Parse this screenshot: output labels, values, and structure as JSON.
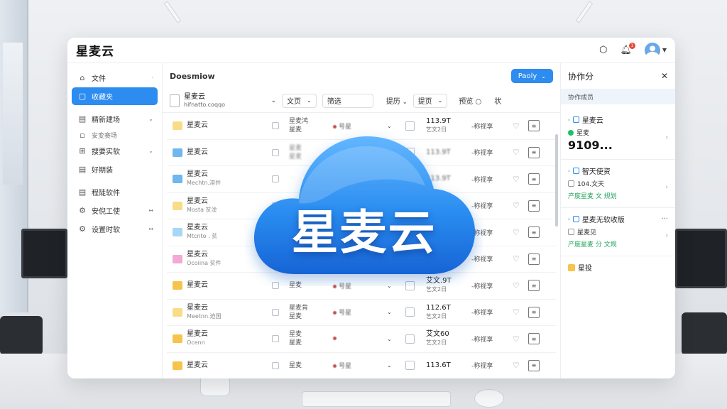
{
  "app": {
    "title": "星麦云",
    "notification_badge": "1"
  },
  "sidebar": {
    "items": [
      {
        "label": "文件",
        "icon": "home-icon",
        "arrow": "·",
        "active": false
      },
      {
        "label": "收藏夹",
        "icon": "folder-icon",
        "arrow": "",
        "active": true
      },
      {
        "label": "精新建场",
        "icon": "doc-icon",
        "arrow": "⌄",
        "active": false
      },
      {
        "label": "安变赛场",
        "icon": "square-icon",
        "arrow": "",
        "active": false,
        "sub": true
      },
      {
        "label": "搜要实软",
        "icon": "clip-icon",
        "arrow": "⌄",
        "active": false
      },
      {
        "label": "好期装",
        "icon": "doc-icon",
        "arrow": "",
        "active": false
      },
      {
        "label": "程陡软件",
        "icon": "doc-icon",
        "arrow": "",
        "active": false
      },
      {
        "label": "安倪工使",
        "icon": "gear-icon",
        "arrow": "↔",
        "active": false
      },
      {
        "label": "设置时软",
        "icon": "gear-icon",
        "arrow": "↔",
        "active": false
      }
    ]
  },
  "main": {
    "title": "Doesmiow",
    "primary_button": "Paoly",
    "filters": {
      "folder_title": "星麦云",
      "folder_sub": "hifnatto.coqqo",
      "type_label": "文页",
      "search_label": "筛选",
      "sort_label": "提历",
      "sort2_label": "提页",
      "view_label": "预览",
      "more_label": "状"
    },
    "rows": [
      {
        "name": "星麦云",
        "sub": "",
        "icon": "ylt",
        "owner": "星麦鸿",
        "owner_sub": "星麦",
        "tag": "号星",
        "size": "113.9T",
        "size_sub": "艺文2日",
        "date": "-称视享"
      },
      {
        "name": "星麦云",
        "sub": "",
        "icon": "b",
        "owner": "星麦",
        "owner_sub": "星麦",
        "tag": "",
        "size": "113.9T",
        "size_sub": "",
        "date": "-称视享"
      },
      {
        "name": "星麦云",
        "sub": "Mechtn.滞井",
        "icon": "b",
        "owner": "",
        "owner_sub": "",
        "tag": "",
        "size": "113.9T",
        "size_sub": "",
        "date": "-称视享"
      },
      {
        "name": "星麦云",
        "sub": "Mosta 贫淦",
        "icon": "ylt",
        "owner": "",
        "owner_sub": "",
        "tag": "",
        "size": "",
        "size_sub": "",
        "date": "-称视享"
      },
      {
        "name": "星麦云",
        "sub": "Mtcnto . 贫",
        "icon": "blt",
        "owner": "",
        "owner_sub": "",
        "tag": "",
        "size": "",
        "size_sub": "",
        "date": "-称视享"
      },
      {
        "name": "星麦云",
        "sub": "Ocoiina 贫件",
        "icon": "p",
        "owner": "",
        "owner_sub": "",
        "tag": "",
        "size": "",
        "size_sub": "",
        "date": "-称视享"
      },
      {
        "name": "星麦云",
        "sub": "",
        "icon": "y",
        "owner": "星麦",
        "owner_sub": "",
        "tag": "号星",
        "size": "艾文.9T",
        "size_sub": "艺文2日",
        "date": "-称视享"
      },
      {
        "name": "星麦云",
        "sub": "Meetnn.迫国",
        "icon": "ylt",
        "owner": "星麦肯",
        "owner_sub": "星麦",
        "tag": "号星",
        "size": "112.6T",
        "size_sub": "艺文2日",
        "date": "-称视享"
      },
      {
        "name": "星麦云",
        "sub": "Ocenn",
        "icon": "y",
        "owner": "星麦",
        "owner_sub": "星麦",
        "tag": "",
        "size": "艾文60",
        "size_sub": "艺文2日",
        "date": "-称视享"
      },
      {
        "name": "星麦云",
        "sub": "",
        "icon": "y",
        "owner": "星麦",
        "owner_sub": "",
        "tag": "号星",
        "size": "113.6T",
        "size_sub": "",
        "date": "-称视享"
      }
    ]
  },
  "panel": {
    "title": "协作分",
    "subtitle": "协作成员",
    "cards": [
      {
        "title": "星麦云",
        "line1": "星麦",
        "big": "9109...",
        "line2": ""
      },
      {
        "title": "智天使资",
        "line1": "104.文天",
        "big": "",
        "line2": "产度星麦 文 规划"
      },
      {
        "title": "星麦无软收版",
        "line1": "星麦见",
        "big": "",
        "line2": "产度星麦 分 文规"
      },
      {
        "title": "星投",
        "line1": "",
        "big": "",
        "line2": ""
      }
    ]
  },
  "logo": {
    "text": "星麦云",
    "colors": {
      "light": "#63b6ff",
      "mid": "#2a8df0",
      "dark": "#1764d6"
    }
  }
}
